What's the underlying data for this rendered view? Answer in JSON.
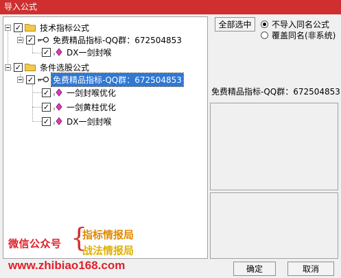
{
  "window": {
    "title": "导入公式"
  },
  "tree": {
    "nodes": [
      {
        "label": "技术指标公式",
        "checked": true,
        "kind": "folder"
      },
      {
        "label": "免费精品指标-QQ群：672504853",
        "checked": true,
        "kind": "group"
      },
      {
        "label": "DX一剑封喉",
        "checked": true,
        "kind": "formula"
      },
      {
        "label": "条件选股公式",
        "checked": true,
        "kind": "folder"
      },
      {
        "label": "免费精品指标-QQ群：672504853",
        "checked": true,
        "kind": "group",
        "selected": true
      },
      {
        "label": "一剑封喉优化",
        "checked": true,
        "kind": "formula"
      },
      {
        "label": "一剑黄柱优化",
        "checked": true,
        "kind": "formula"
      },
      {
        "label": "DX一剑封喉",
        "checked": true,
        "kind": "formula"
      }
    ]
  },
  "right": {
    "select_all_label": "全部选中",
    "radio_options": [
      {
        "label": "不导入同名公式",
        "checked": true
      },
      {
        "label": "覆盖同名(非系统)",
        "checked": false
      }
    ],
    "formula_name": "免费精品指标-QQ群：672504853"
  },
  "watermark": {
    "gzh": "微信公众号",
    "brace": "{",
    "line1": "指标情报局",
    "line2": "战法情报局",
    "url": "www.zhibiao168.com"
  },
  "footer": {
    "ok_label": "确定",
    "cancel_label": "取消"
  },
  "colors": {
    "titlebar": "#cf2f2f",
    "selection": "#2f78d4",
    "folder": "#f2c94c",
    "formula_icon": "#d63fb5"
  }
}
